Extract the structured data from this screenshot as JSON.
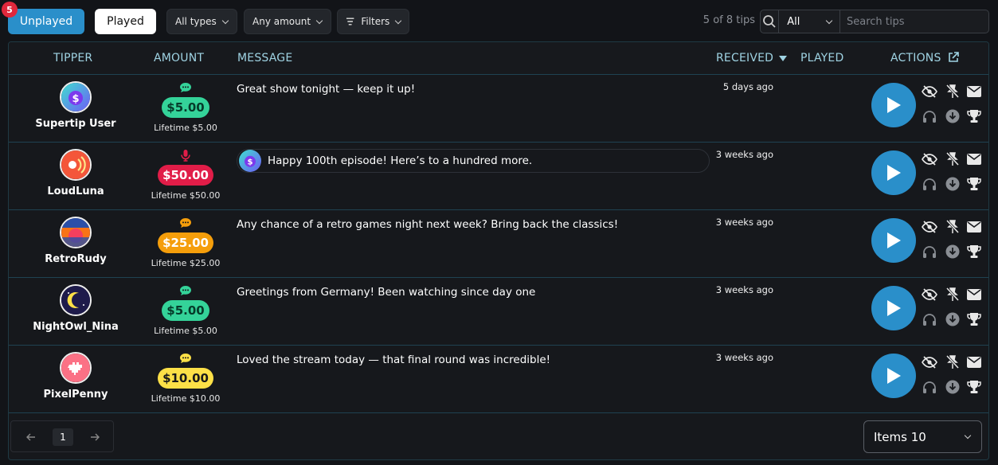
{
  "tabs": {
    "unplayed_label": "Unplayed",
    "unplayed_badge": "5",
    "played_label": "Played"
  },
  "filters": {
    "types": "All types",
    "amount": "Any amount",
    "filters": "Filters"
  },
  "count_text": "5 of 8 tips",
  "search": {
    "scope": "All",
    "placeholder": "Search tips"
  },
  "columns": {
    "tipper": "TIPPER",
    "amount": "AMOUNT",
    "message": "MESSAGE",
    "received": "RECEIVED",
    "played": "PLAYED",
    "actions": "ACTIONS"
  },
  "rows": [
    {
      "name": "Supertip User",
      "amount": "$5.00",
      "lifetime": "Lifetime $5.00",
      "message": "Great show tonight — keep it up!",
      "received": "5 days ago",
      "type": "chat",
      "chip_color": "#34d399",
      "avatar": "superhero"
    },
    {
      "name": "LoudLuna",
      "amount": "$50.00",
      "lifetime": "Lifetime $50.00",
      "message": "Happy 100th episode! Here’s to a hundred more.",
      "received": "3 weeks ago",
      "type": "voice",
      "chip_color": "#e11d48",
      "avatar": "loudspeaker"
    },
    {
      "name": "RetroRudy",
      "amount": "$25.00",
      "lifetime": "Lifetime $25.00",
      "message": "Any chance of a retro games night next week? Bring back the classics!",
      "received": "3 weeks ago",
      "type": "chat",
      "chip_color": "#f59e0b",
      "avatar": "sunset"
    },
    {
      "name": "NightOwl_Nina",
      "amount": "$5.00",
      "lifetime": "Lifetime $5.00",
      "message": "Greetings from Germany! Been watching since day one",
      "received": "3 weeks ago",
      "type": "chat",
      "chip_color": "#34d399",
      "avatar": "moon"
    },
    {
      "name": "PixelPenny",
      "amount": "$10.00",
      "lifetime": "Lifetime $10.00",
      "message": "Loved the stream today — that final round was incredible!",
      "received": "3 weeks ago",
      "type": "chat",
      "chip_color": "#fde047",
      "avatar": "pixel-heart"
    }
  ],
  "pagination": {
    "page": "1"
  },
  "per_page": "Items 10"
}
